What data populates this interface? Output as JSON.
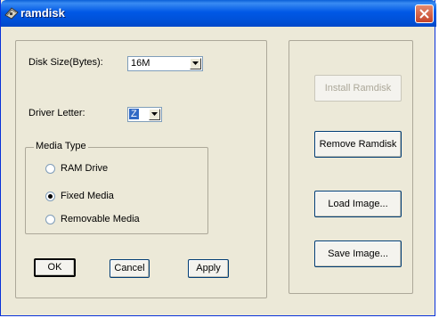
{
  "window": {
    "title": "ramdisk",
    "icon": "ramdisk-app-icon",
    "close_icon": "close-icon"
  },
  "disk_size": {
    "label": "Disk Size(Bytes):",
    "value": "16M"
  },
  "driver_letter": {
    "label": "Driver Letter:",
    "value": "Z"
  },
  "media_type": {
    "legend": "Media Type",
    "options": [
      {
        "label": "RAM Drive",
        "checked": false
      },
      {
        "label": "Fixed Media",
        "checked": true
      },
      {
        "label": "Removable Media",
        "checked": false
      }
    ]
  },
  "bottom_buttons": {
    "ok": "OK",
    "cancel": "Cancel",
    "apply": "Apply"
  },
  "side_buttons": {
    "install": "Install Ramdisk",
    "remove": "Remove Ramdisk",
    "load": "Load Image...",
    "save": "Save Image..."
  },
  "colors": {
    "titlebar": "#0058e6",
    "face": "#ece9d8",
    "selection": "#316ac5"
  }
}
